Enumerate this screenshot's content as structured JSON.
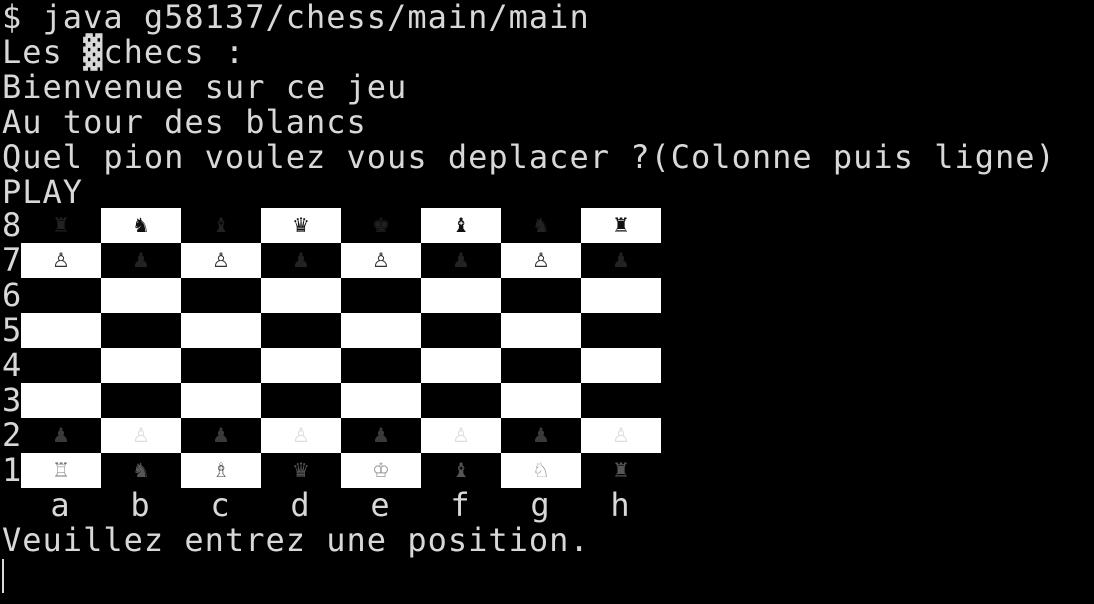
{
  "terminal": {
    "lines": [
      "$ java g58137/chess/main/main",
      "Les ▓checs :",
      "Bienvenue sur ce jeu",
      "Au tour des blancs",
      "Quel pion voulez vous deplacer ?(Colonne puis ligne)",
      "PLAY"
    ],
    "prompt": "Veuillez entrez une position."
  },
  "board": {
    "files": [
      "a",
      "b",
      "c",
      "d",
      "e",
      "f",
      "g",
      "h"
    ],
    "ranks": [
      {
        "label": "8",
        "squares": [
          {
            "piece": "♜",
            "color": "#222222",
            "name": "black-rook"
          },
          {
            "piece": "♞",
            "color": "#111111",
            "name": "black-knight"
          },
          {
            "piece": "♝",
            "color": "#222222",
            "name": "black-bishop"
          },
          {
            "piece": "♛",
            "color": "#111111",
            "name": "black-queen"
          },
          {
            "piece": "♚",
            "color": "#222222",
            "name": "black-king"
          },
          {
            "piece": "♝",
            "color": "#111111",
            "name": "black-bishop"
          },
          {
            "piece": "♞",
            "color": "#222222",
            "name": "black-knight"
          },
          {
            "piece": "♜",
            "color": "#111111",
            "name": "black-rook"
          }
        ]
      },
      {
        "label": "7",
        "squares": [
          {
            "piece": "♙",
            "color": "#333333",
            "name": "black-pawn"
          },
          {
            "piece": "♟",
            "color": "#222222",
            "name": "black-pawn"
          },
          {
            "piece": "♙",
            "color": "#333333",
            "name": "black-pawn"
          },
          {
            "piece": "♟",
            "color": "#222222",
            "name": "black-pawn"
          },
          {
            "piece": "♙",
            "color": "#333333",
            "name": "black-pawn"
          },
          {
            "piece": "♟",
            "color": "#222222",
            "name": "black-pawn"
          },
          {
            "piece": "♙",
            "color": "#333333",
            "name": "black-pawn"
          },
          {
            "piece": "♟",
            "color": "#222222",
            "name": "black-pawn"
          }
        ]
      },
      {
        "label": "6",
        "squares": [
          {
            "piece": ""
          },
          {
            "piece": ""
          },
          {
            "piece": ""
          },
          {
            "piece": ""
          },
          {
            "piece": ""
          },
          {
            "piece": ""
          },
          {
            "piece": ""
          },
          {
            "piece": ""
          }
        ]
      },
      {
        "label": "5",
        "squares": [
          {
            "piece": ""
          },
          {
            "piece": ""
          },
          {
            "piece": ""
          },
          {
            "piece": ""
          },
          {
            "piece": ""
          },
          {
            "piece": ""
          },
          {
            "piece": ""
          },
          {
            "piece": ""
          }
        ]
      },
      {
        "label": "4",
        "squares": [
          {
            "piece": ""
          },
          {
            "piece": ""
          },
          {
            "piece": ""
          },
          {
            "piece": ""
          },
          {
            "piece": ""
          },
          {
            "piece": ""
          },
          {
            "piece": ""
          },
          {
            "piece": ""
          }
        ]
      },
      {
        "label": "3",
        "squares": [
          {
            "piece": ""
          },
          {
            "piece": ""
          },
          {
            "piece": ""
          },
          {
            "piece": ""
          },
          {
            "piece": ""
          },
          {
            "piece": ""
          },
          {
            "piece": ""
          },
          {
            "piece": ""
          }
        ]
      },
      {
        "label": "2",
        "squares": [
          {
            "piece": "♟",
            "color": "#3a3a3a",
            "name": "white-pawn"
          },
          {
            "piece": "♙",
            "color": "#dddddd",
            "name": "white-pawn"
          },
          {
            "piece": "♟",
            "color": "#3a3a3a",
            "name": "white-pawn"
          },
          {
            "piece": "♙",
            "color": "#dddddd",
            "name": "white-pawn"
          },
          {
            "piece": "♟",
            "color": "#3a3a3a",
            "name": "white-pawn"
          },
          {
            "piece": "♙",
            "color": "#dddddd",
            "name": "white-pawn"
          },
          {
            "piece": "♟",
            "color": "#3a3a3a",
            "name": "white-pawn"
          },
          {
            "piece": "♙",
            "color": "#dddddd",
            "name": "white-pawn"
          }
        ]
      },
      {
        "label": "1",
        "squares": [
          {
            "piece": "♖",
            "color": "#777777",
            "name": "white-rook"
          },
          {
            "piece": "♞",
            "color": "#555555",
            "name": "white-knight"
          },
          {
            "piece": "♗",
            "color": "#666666",
            "name": "white-bishop"
          },
          {
            "piece": "♛",
            "color": "#555555",
            "name": "white-queen"
          },
          {
            "piece": "♔",
            "color": "#999999",
            "name": "white-king"
          },
          {
            "piece": "♝",
            "color": "#555555",
            "name": "white-bishop"
          },
          {
            "piece": "♘",
            "color": "#888888",
            "name": "white-knight"
          },
          {
            "piece": "♜",
            "color": "#555555",
            "name": "white-rook"
          }
        ]
      }
    ]
  },
  "colors": {
    "background": "#000000",
    "text": "#d8d8d8",
    "light_square": "#ffffff",
    "dark_square": "#000000"
  }
}
